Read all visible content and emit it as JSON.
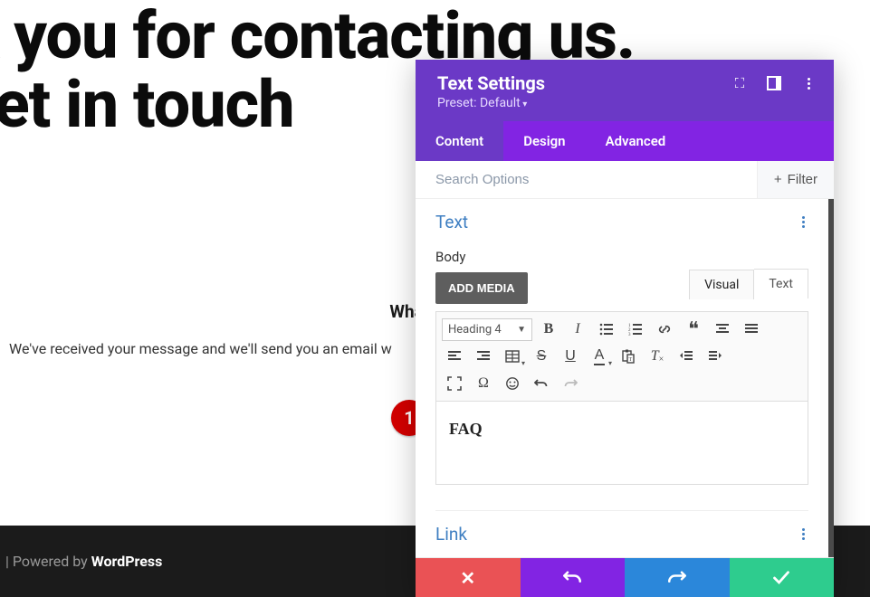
{
  "page": {
    "heroLine1": "Thank you for contacting us.",
    "heroLine2": "we'll get in touch",
    "whatsNext": "What's Next",
    "received": "We've received your message and we'll send you an email w",
    "faq": "FAQ",
    "footer_prefix": " | Powered by ",
    "footer_bold": "WordPress"
  },
  "badge": "1",
  "panel": {
    "title": "Text Settings",
    "preset": "Preset: Default",
    "tabs": {
      "content": "Content",
      "design": "Design",
      "advanced": "Advanced"
    },
    "search_placeholder": "Search Options",
    "filter_label": "Filter",
    "section_text": "Text",
    "body_label": "Body",
    "add_media": "ADD MEDIA",
    "visual": "Visual",
    "text_tab": "Text",
    "format": "Heading 4",
    "editor_content": "FAQ",
    "section_link": "Link"
  }
}
